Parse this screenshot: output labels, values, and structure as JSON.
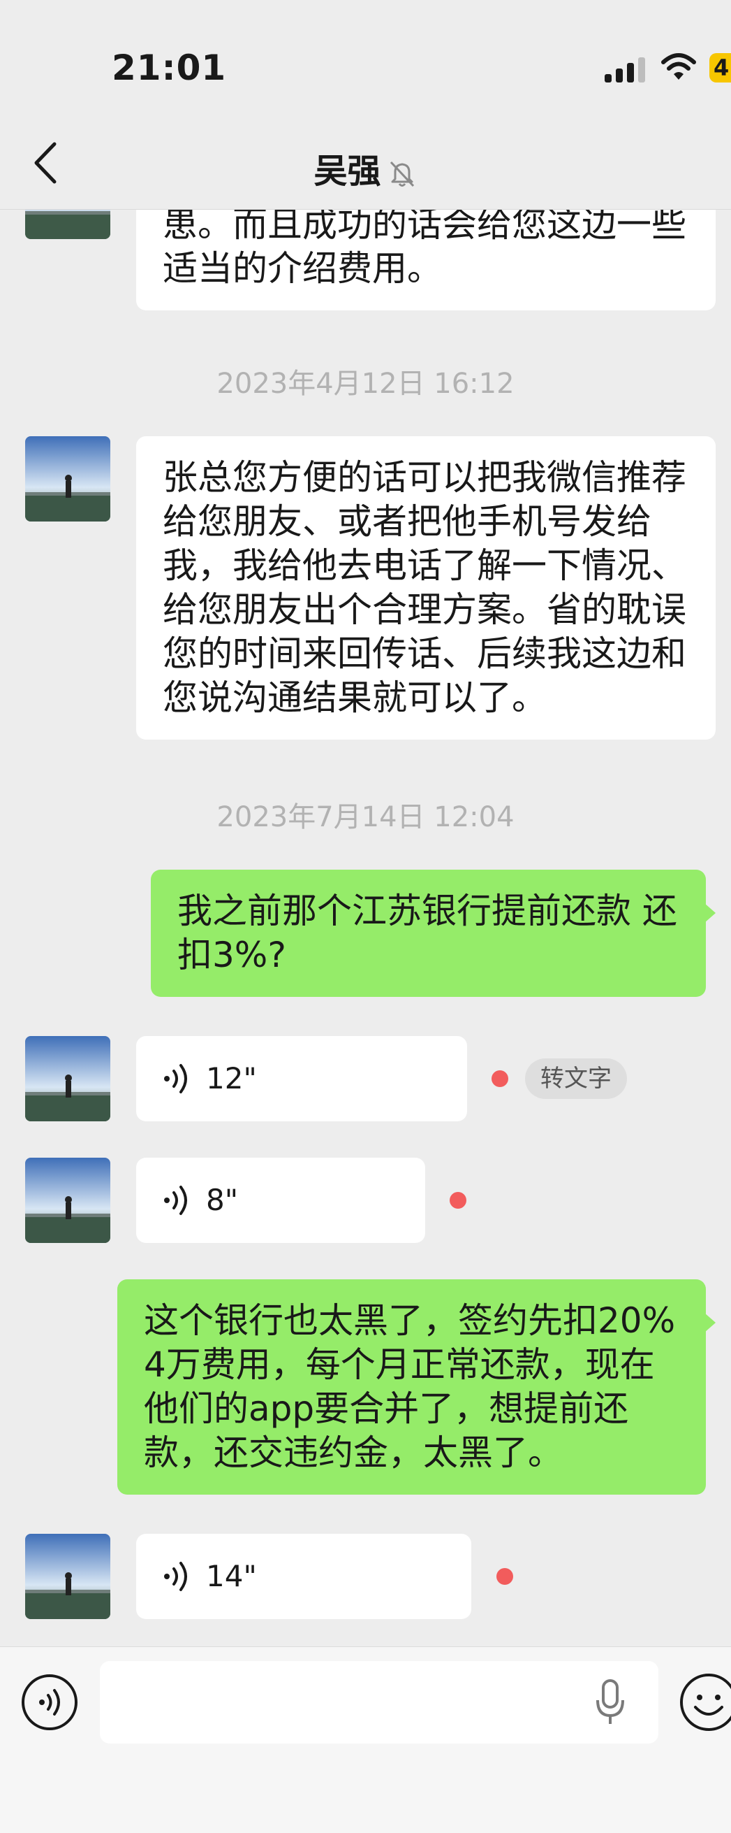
{
  "status_bar": {
    "time": "21:01",
    "battery": "4"
  },
  "header": {
    "title": "吴强"
  },
  "messages": {
    "partial_in": "患。而且成功的话会给您这边一些\n适当的介绍费用。",
    "ts1": "2023年4月12日 16:12",
    "msg_in_1": "张总您方便的话可以把我微信推荐\n给您朋友、或者把他手机号发给\n我，我给他去电话了解一下情况、\n给您朋友出个合理方案。省的耽误\n您的时间来回传话、后续我这边和\n您说沟通结果就可以了。",
    "ts2": "2023年7月14日 12:04",
    "msg_out_1": "我之前那个江苏银行提前还款 还\n扣3%?",
    "voice_1": "12\"",
    "to_text_label": "转文字",
    "voice_2": "8\"",
    "msg_out_2": "这个银行也太黑了，签约先扣20%\n4万费用，每个月正常还款，现在\n他们的app要合并了，想提前还\n款，还交违约金，太黑了。",
    "voice_3": "14\""
  },
  "input_bar": {
    "placeholder": ""
  },
  "colors": {
    "background": "#ededed",
    "incoming_bubble": "#ffffff",
    "outgoing_bubble": "#95ec69",
    "unread_dot": "#f25c5c"
  }
}
